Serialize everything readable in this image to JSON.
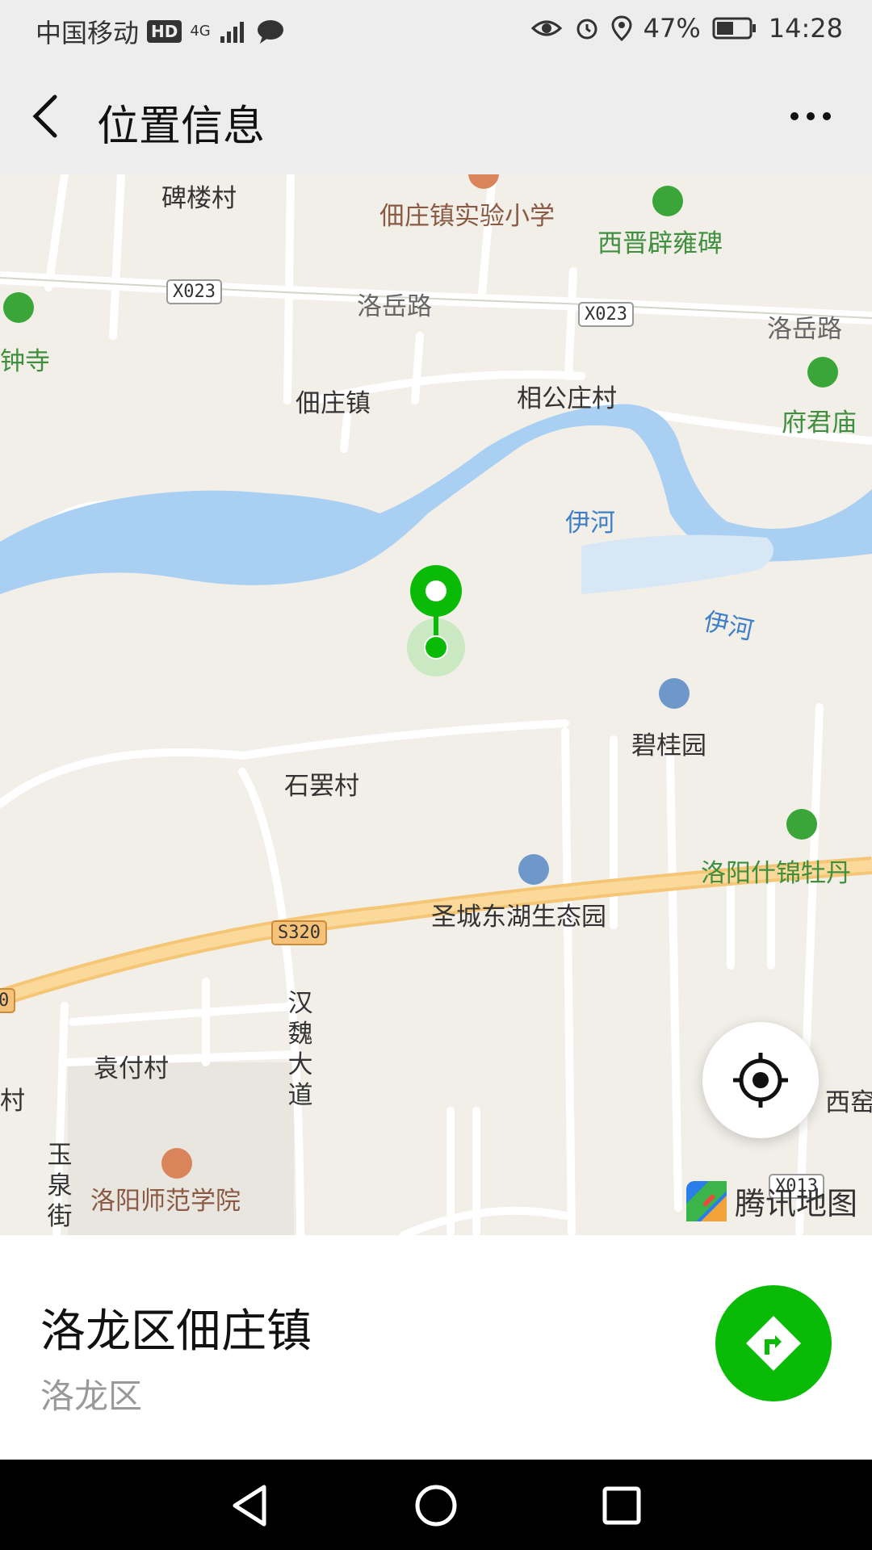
{
  "status_bar": {
    "carrier": "中国移动",
    "hd": "HD",
    "network": "4G",
    "battery_percent": "47%",
    "time": "14:28"
  },
  "app_bar": {
    "title": "位置信息"
  },
  "map": {
    "labels": {
      "beilou": "碑楼村",
      "school": "佃庄镇实验小学",
      "xijin": "西晋辟雍碑",
      "road_luoyue_1": "洛岳路",
      "road_luoyue_2": "洛岳路",
      "zhongsi": "钟寺",
      "dianzhuang": "佃庄镇",
      "xianggong": "相公庄村",
      "fujun": "府君庙",
      "yihe_1": "伊河",
      "yihe_2": "伊河",
      "bigui": "碧桂园",
      "shiba": "石罢村",
      "mudan": "洛阳什锦牡丹",
      "shengcheng": "圣城东湖生态园",
      "hanwei": "汉魏大道",
      "yuanfu": "袁付村",
      "cun_left": "村",
      "xiyao": "西窑",
      "yuquan": "玉泉街",
      "college": "洛阳师范学院",
      "logo": "腾讯地图"
    },
    "shields": {
      "x023_a": "X023",
      "x023_b": "X023",
      "s320": "S320",
      "s320_edge": "0",
      "x013": "X013"
    }
  },
  "location": {
    "name": "洛龙区佃庄镇",
    "district": "洛龙区"
  },
  "colors": {
    "accent_green": "#09bb07",
    "water": "#a9cff2",
    "poi_green": "#3aa63a"
  }
}
